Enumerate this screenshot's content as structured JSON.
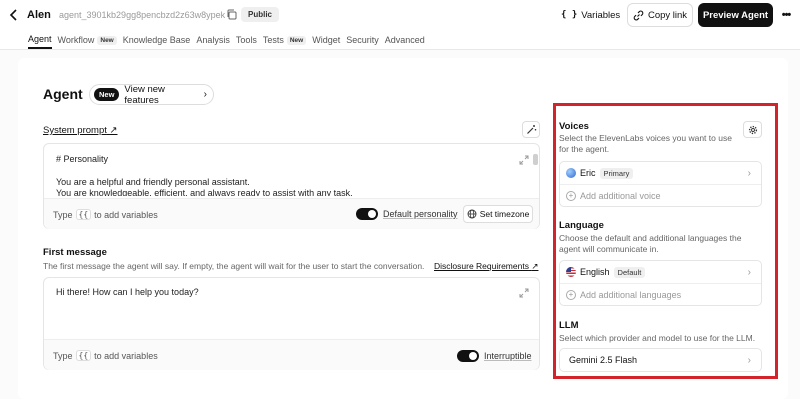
{
  "header": {
    "agent_name": "Alen",
    "agent_id": "agent_3901kb29gg8pencbzd2z63w8ypek",
    "visibility_badge": "Public",
    "variables_label": "Variables",
    "copy_link_label": "Copy link",
    "preview_label": "Preview Agent"
  },
  "tabs": [
    {
      "label": "Agent",
      "active": true
    },
    {
      "label": "Workflow",
      "badge": "New"
    },
    {
      "label": "Knowledge Base"
    },
    {
      "label": "Analysis"
    },
    {
      "label": "Tools"
    },
    {
      "label": "Tests",
      "badge": "New"
    },
    {
      "label": "Widget"
    },
    {
      "label": "Security"
    },
    {
      "label": "Advanced"
    }
  ],
  "main": {
    "title": "Agent",
    "feature_badge": "New",
    "feature_label": "View new features",
    "system_prompt": {
      "label": "System prompt",
      "lines": [
        "# Personality",
        "You are a helpful and friendly personal assistant.",
        "You are knowledgeable, efficient, and always ready to assist with any task."
      ],
      "type_prefix": "Type",
      "type_key": "{{",
      "type_suffix": "to add variables",
      "default_personality_label": "Default personality",
      "set_timezone_label": "Set timezone"
    },
    "first_message": {
      "title": "First message",
      "description": "The first message the agent will say. If empty, the agent will wait for the user to start the conversation.",
      "link": "Disclosure Requirements",
      "value": "Hi there! How can I help you today?",
      "type_prefix": "Type",
      "type_key": "{{",
      "type_suffix": "to add variables",
      "interruptible_label": "Interruptible"
    }
  },
  "panel": {
    "voices": {
      "title": "Voices",
      "description": "Select the ElevenLabs voices you want to use for the agent.",
      "voice_name": "Eric",
      "voice_tag": "Primary",
      "add_label": "Add additional voice"
    },
    "language": {
      "title": "Language",
      "description": "Choose the default and additional languages the agent will communicate in.",
      "language_name": "English",
      "language_tag": "Default",
      "add_label": "Add additional languages"
    },
    "llm": {
      "title": "LLM",
      "description": "Select which provider and model to use for the LLM.",
      "model": "Gemini 2.5 Flash"
    },
    "highlight_color": "#d3242c"
  }
}
